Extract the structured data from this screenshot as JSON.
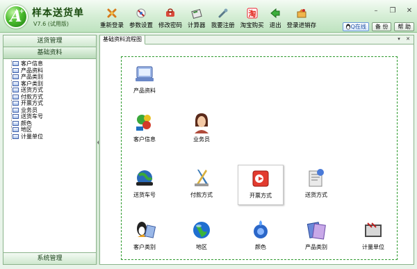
{
  "app": {
    "logo_text": "A",
    "title": "样本送货单",
    "version": "V7.6 (试用版)"
  },
  "toolbar": [
    {
      "label": "重新登录",
      "icon": "relogin-icon"
    },
    {
      "label": "参数设置",
      "icon": "settings-icon"
    },
    {
      "label": "修改密码",
      "icon": "password-icon"
    },
    {
      "label": "计算器",
      "icon": "calculator-icon"
    },
    {
      "label": "我要注册",
      "icon": "register-icon"
    },
    {
      "label": "淘宝购买",
      "icon": "taobao-icon"
    },
    {
      "label": "退出",
      "icon": "exit-icon"
    },
    {
      "label": "登录进销存",
      "icon": "login-erp-icon"
    }
  ],
  "window_controls": {
    "minimize": "–",
    "restore": "❐",
    "close": "✕"
  },
  "top_buttons": {
    "qq": "Q在线",
    "backup": "备 份",
    "help": "帮 助"
  },
  "sidebar": {
    "sections": [
      "送货管理",
      "基础资料"
    ],
    "bottom_section": "系统管理",
    "items": [
      "客户信息",
      "产品资料",
      "产品类别",
      "客户类别",
      "送货方式",
      "付款方式",
      "开票方式",
      "业务员",
      "送货车号",
      "颜色",
      "地区",
      "计量单位"
    ]
  },
  "main": {
    "tab_label": "基础资料流程图",
    "tab_controls": [
      "▾",
      "✕"
    ],
    "items": [
      {
        "label": "产品资料",
        "icon": "product-info-icon"
      },
      {
        "label": "客户信息",
        "icon": "customer-info-icon"
      },
      {
        "label": "业务员",
        "icon": "salesperson-icon"
      },
      {
        "label": "送货车号",
        "icon": "delivery-car-icon"
      },
      {
        "label": "付款方式",
        "icon": "payment-method-icon"
      },
      {
        "label": "开票方式",
        "icon": "invoice-method-icon"
      },
      {
        "label": "送货方式",
        "icon": "delivery-method-icon"
      },
      {
        "label": "客户类别",
        "icon": "customer-category-icon"
      },
      {
        "label": "地区",
        "icon": "region-globe-icon"
      },
      {
        "label": "颜色",
        "icon": "color-icon"
      },
      {
        "label": "产品类别",
        "icon": "product-category-icon"
      },
      {
        "label": "计量单位",
        "icon": "measure-unit-icon"
      }
    ]
  }
}
